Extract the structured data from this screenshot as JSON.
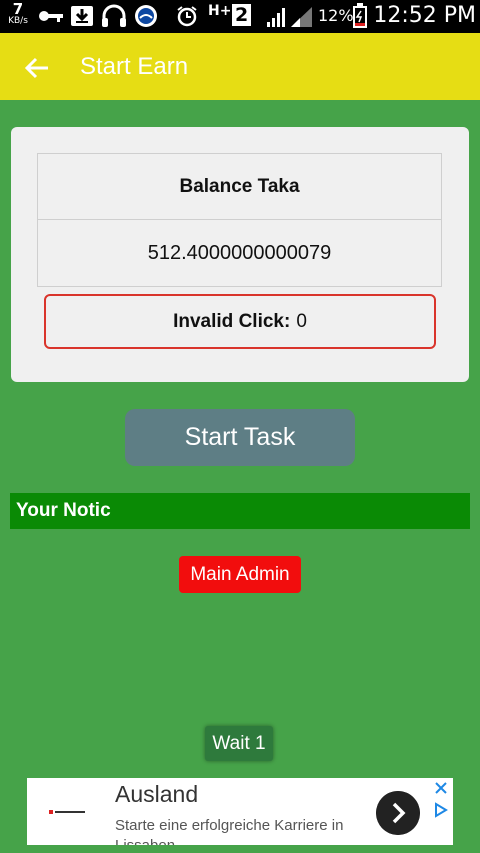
{
  "statusbar": {
    "speed_value": "7",
    "speed_unit": "KB/s",
    "network_type": "H+",
    "sim_slot": "2",
    "battery_percent": "12%",
    "time": "12:52 PM",
    "icons": [
      "key-icon",
      "download-icon",
      "headphones-icon",
      "app-icon",
      "alarm-icon",
      "signal-icon",
      "battery-icon"
    ]
  },
  "toolbar": {
    "title": "Start Earn",
    "background": "#e6dd14"
  },
  "balance": {
    "label": "Balance Taka",
    "value": "512.4000000000079"
  },
  "invalid_click": {
    "label": "Invalid Click:",
    "value": "0"
  },
  "start_task": {
    "label": "Start Task",
    "color": "#5e7e85"
  },
  "notice": {
    "title": "Your Notic",
    "admin_button": "Main Admin"
  },
  "wait": {
    "label": "Wait 1"
  },
  "ad": {
    "title": "Ausland",
    "subtitle": "Starte eine erfolgreiche Karriere in Lissabon",
    "icons": [
      "close-icon",
      "adchoices-icon",
      "arrow-right-icon"
    ]
  },
  "colors": {
    "page_background": "#46a349",
    "notice_bar": "#0a8a05",
    "admin_button": "#f20d0d",
    "invalid_border": "#d9342b"
  }
}
